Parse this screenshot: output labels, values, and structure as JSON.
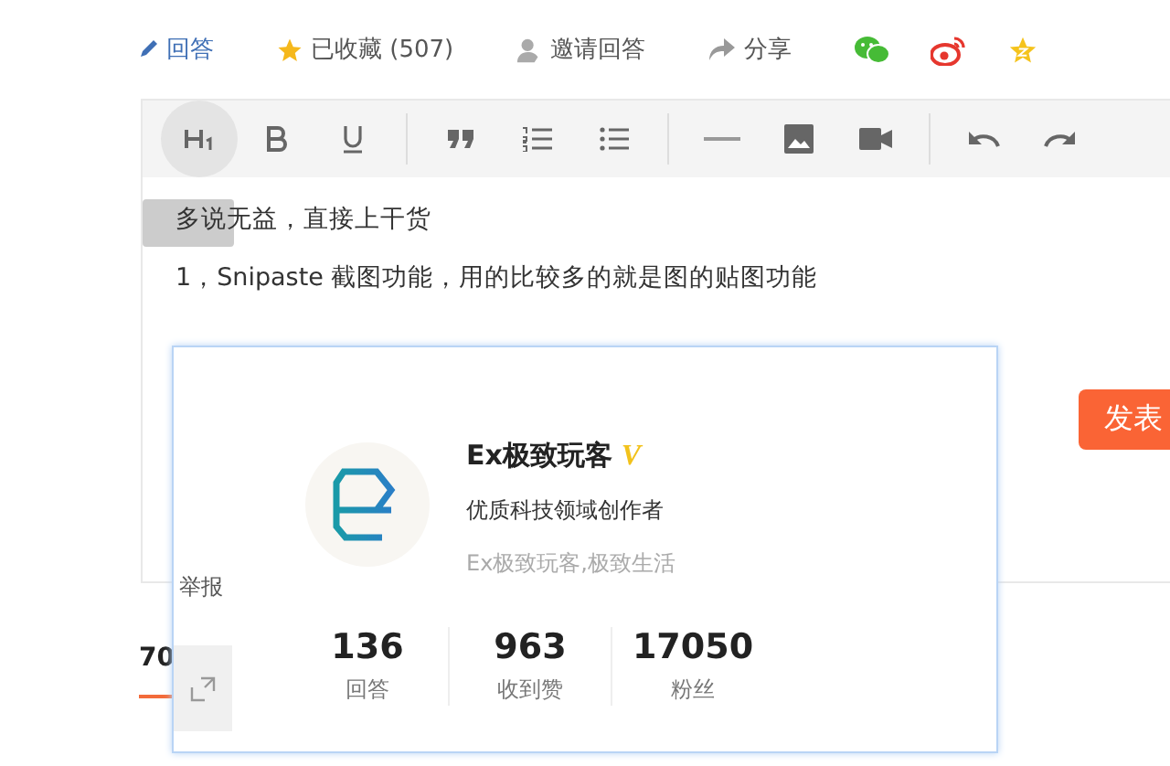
{
  "actions": [
    {
      "kind": "answer",
      "label": "回答"
    },
    {
      "kind": "favorite",
      "label": "已收藏 (507)"
    },
    {
      "kind": "invite",
      "label": "邀请回答"
    },
    {
      "kind": "share",
      "label": "分享"
    },
    {
      "kind": "wechat"
    },
    {
      "kind": "weibo"
    },
    {
      "kind": "qzone"
    }
  ],
  "toolbar": [
    {
      "kind": "h1",
      "selected": true
    },
    {
      "kind": "bold",
      "selected": false
    },
    {
      "kind": "underline",
      "selected": false
    },
    {
      "kind": "sep"
    },
    {
      "kind": "quote",
      "selected": false
    },
    {
      "kind": "ol",
      "selected": false
    },
    {
      "kind": "ul",
      "selected": false
    },
    {
      "kind": "sep"
    },
    {
      "kind": "hr",
      "selected": false
    },
    {
      "kind": "image",
      "selected": false
    },
    {
      "kind": "video",
      "selected": false
    },
    {
      "kind": "sep"
    },
    {
      "kind": "undo",
      "selected": false
    },
    {
      "kind": "redo",
      "selected": false
    }
  ],
  "editor": {
    "paragraphs": [
      "多说无益，直接上干货",
      "1，Snipaste 截图功能，用的比较多的就是图的贴图功能"
    ],
    "submit": "发表",
    "report": "举报"
  },
  "tab_count": "70",
  "profile_card": {
    "name": "Ex极致玩客",
    "verified": true,
    "verified_mark": "V",
    "title": "优质科技领域创作者",
    "motto": "Ex极致玩客,极致生活",
    "stats": [
      {
        "value": "136",
        "label": "回答"
      },
      {
        "value": "963",
        "label": "收到赞"
      },
      {
        "value": "17050",
        "label": "粉丝"
      }
    ]
  }
}
